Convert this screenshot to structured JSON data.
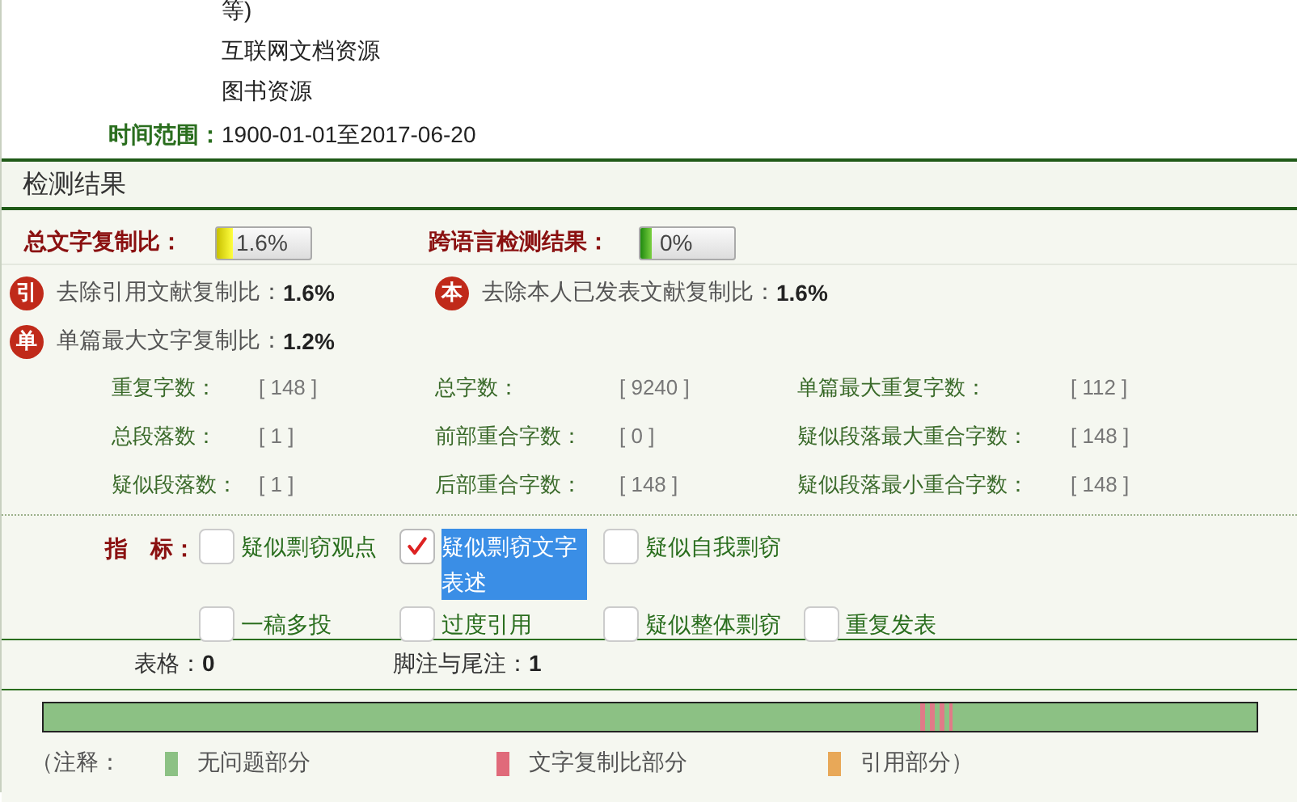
{
  "sources": {
    "lines": [
      "等)",
      "互联网文档资源",
      "图书资源"
    ]
  },
  "time_range": {
    "label": "时间范围：",
    "value": "1900-01-01至2017-06-20"
  },
  "results": {
    "title": "检测结果",
    "meters": [
      {
        "label": "总文字复制比：",
        "reading": "1.6%",
        "level": 0.18,
        "kind": "yellow"
      },
      {
        "label": "跨语言检测结果：",
        "reading": "0%",
        "level": 0.12,
        "kind": "green"
      }
    ],
    "ratios": [
      {
        "badge": "引",
        "label": "去除引用文献复制比：",
        "value": "1.6%"
      },
      {
        "badge": "本",
        "label": "去除本人已发表文献复制比：",
        "value": "1.6%"
      },
      {
        "badge": "单",
        "label": "单篇最大文字复制比：",
        "value": "1.2%"
      }
    ],
    "stats": [
      {
        "label": "重复字数：",
        "value": "[ 148  ]"
      },
      {
        "label": "总字数：",
        "value": "[ 9240 ]"
      },
      {
        "label": "单篇最大重复字数：",
        "value": "[ 112 ]"
      },
      {
        "label": "总段落数：",
        "value": "[ 1  ]"
      },
      {
        "label": "前部重合字数：",
        "value": "[ 0 ]"
      },
      {
        "label": "疑似段落最大重合字数：",
        "value": "[ 148 ]"
      },
      {
        "label": "疑似段落数：",
        "value": "[ 1  ]"
      },
      {
        "label": "后部重合字数：",
        "value": "[ 148 ]"
      },
      {
        "label": "疑似段落最小重合字数：",
        "value": "[ 148 ]"
      }
    ],
    "indicators": {
      "label": "指　标：",
      "rows": [
        [
          {
            "label": "疑似剽窃观点",
            "checked": false,
            "highlighted": false
          },
          {
            "label": "疑似剽窃文字表述",
            "checked": true,
            "highlighted": true
          },
          {
            "label": "疑似自我剽窃",
            "checked": false,
            "highlighted": false
          }
        ],
        [
          {
            "label": "一稿多投",
            "checked": false,
            "highlighted": false
          },
          {
            "label": "过度引用",
            "checked": false,
            "highlighted": false
          },
          {
            "label": "疑似整体剽窃",
            "checked": false,
            "highlighted": false
          },
          {
            "label": "重复发表",
            "checked": false,
            "highlighted": false
          }
        ]
      ]
    },
    "counts": [
      {
        "label": "表格：",
        "value": "0"
      },
      {
        "label": "脚注与尾注：",
        "value": "1"
      }
    ],
    "legend": {
      "prefix": "（注释：",
      "items": [
        {
          "label": "无问题部分",
          "color": "#8cc184"
        },
        {
          "label": "文字复制比部分",
          "color": "#e06a7a"
        },
        {
          "label": "引用部分）",
          "color": "#e8a858"
        }
      ]
    }
  }
}
